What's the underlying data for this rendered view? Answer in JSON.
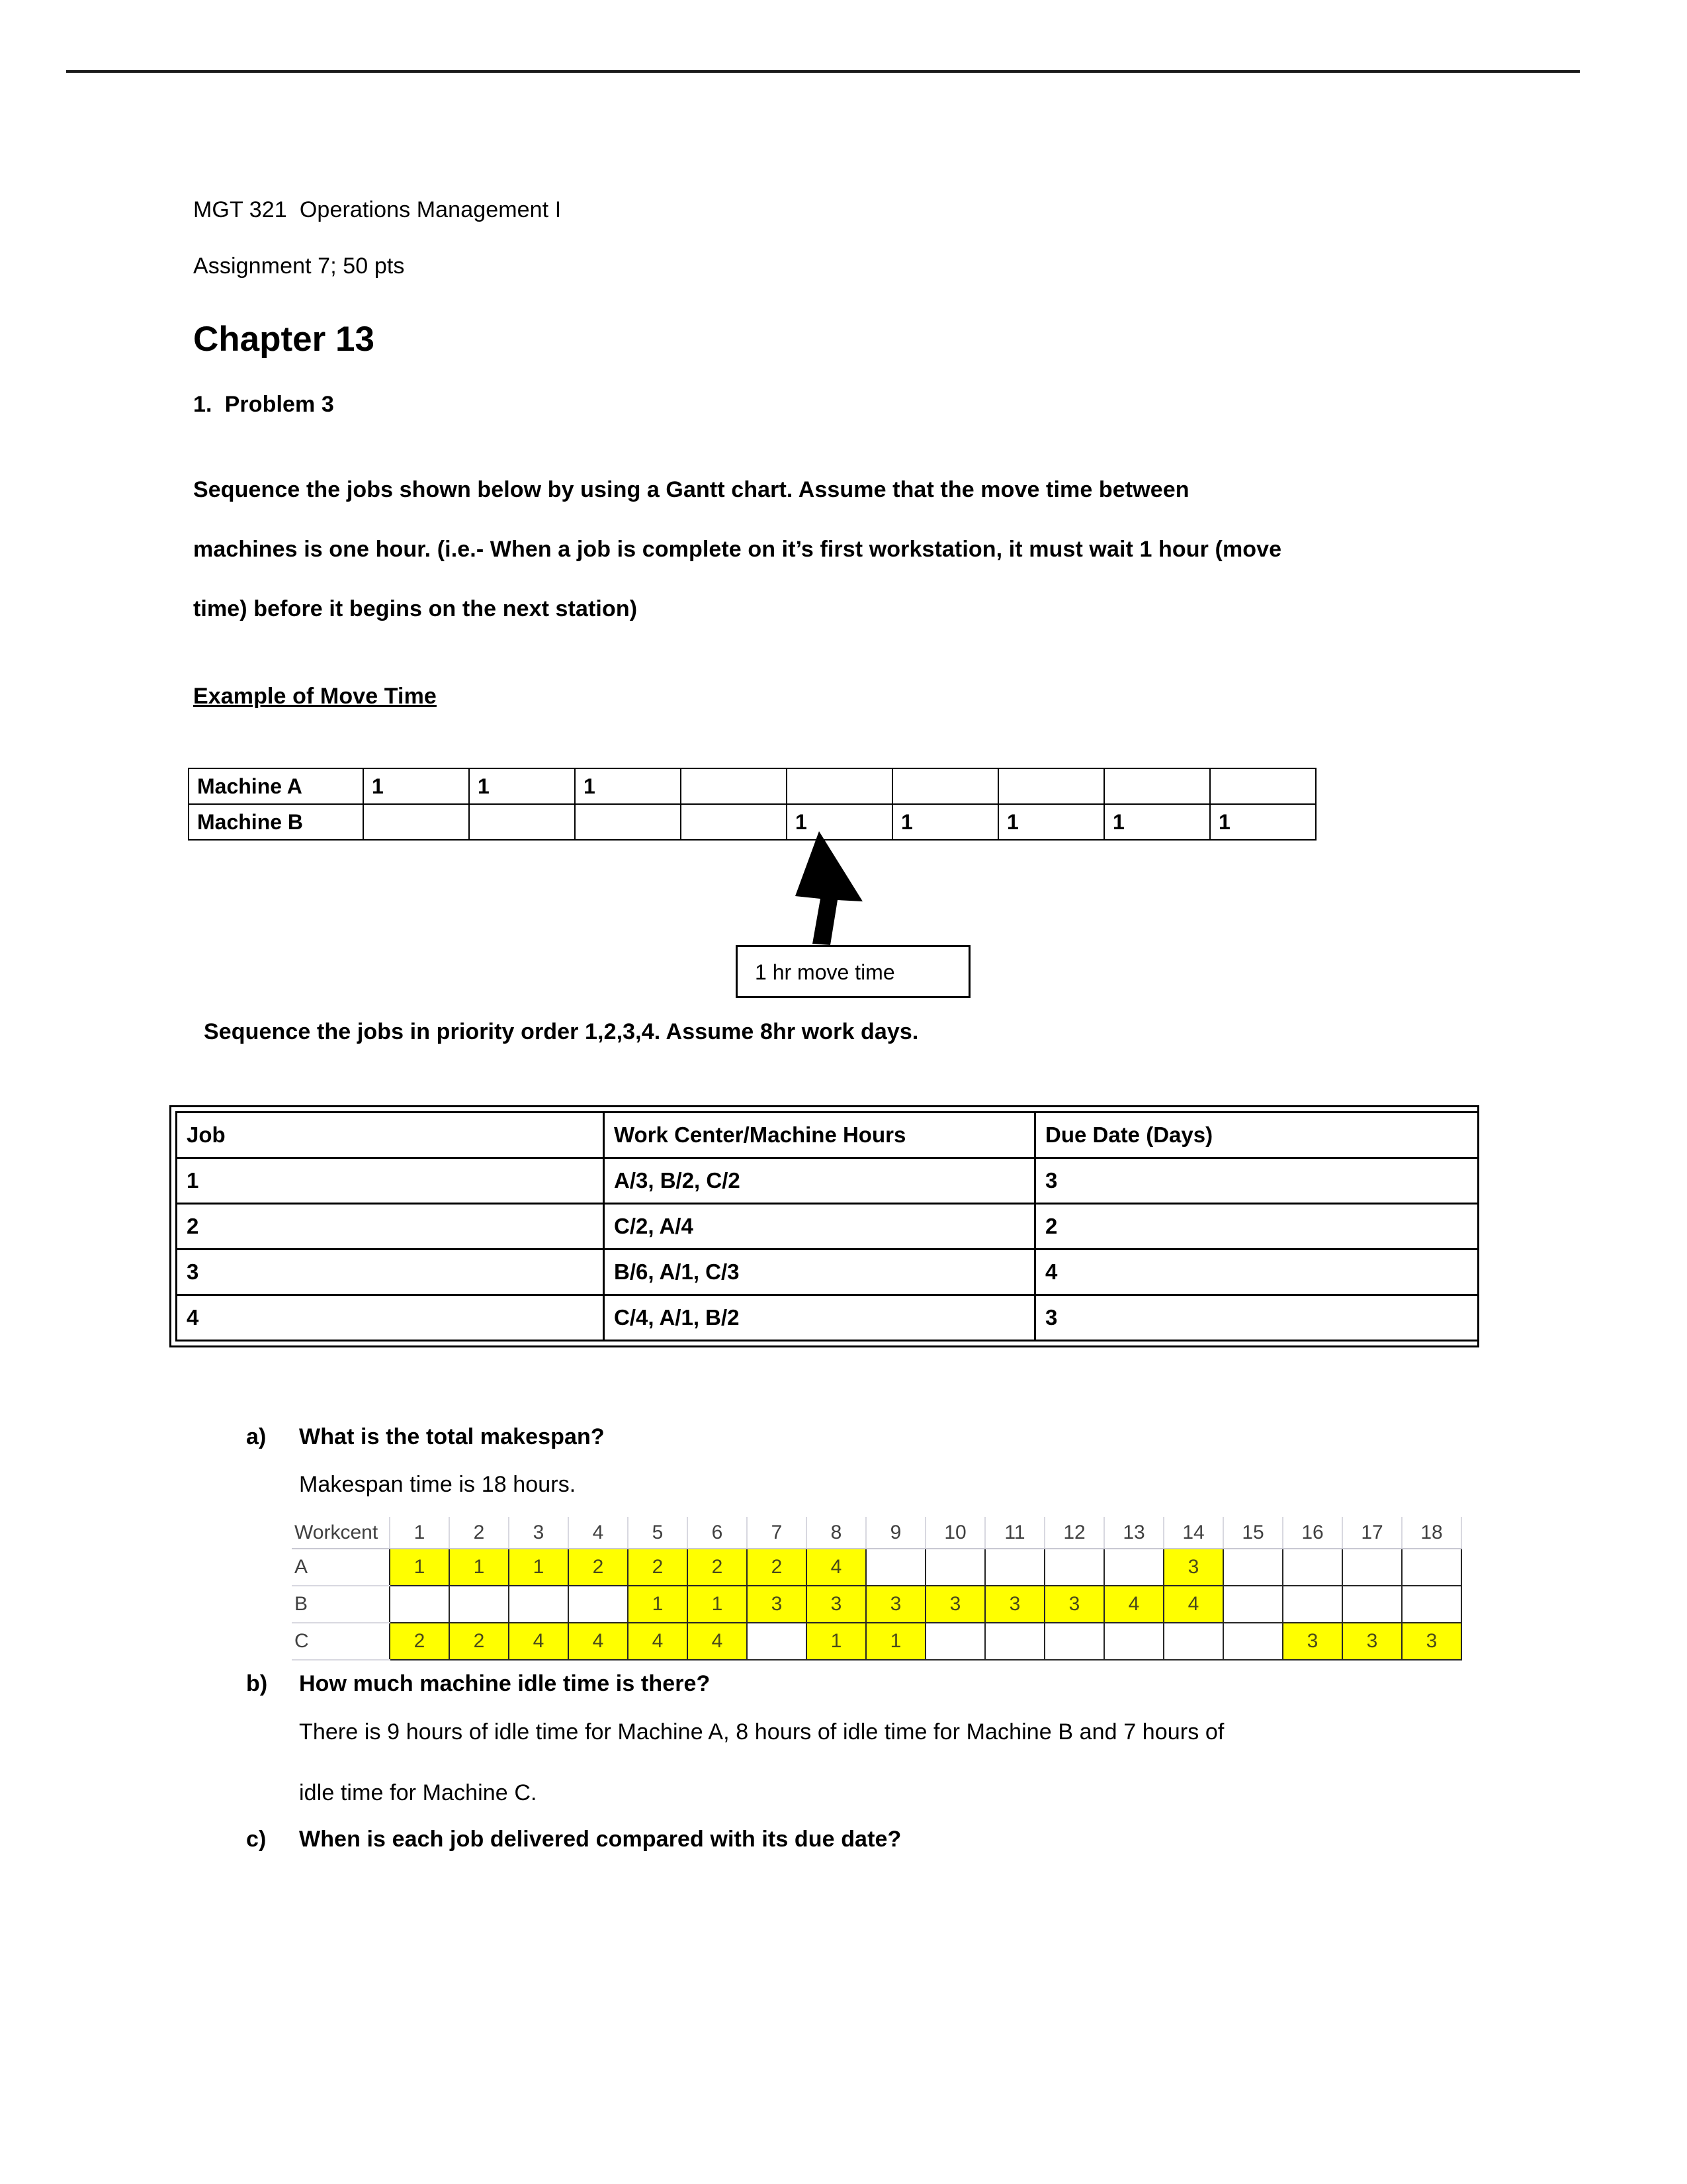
{
  "document": {
    "course_line": "MGT 321  Operations Management I",
    "assignment_line": "Assignment 7; 50 pts",
    "chapter_title": "Chapter 13",
    "problem_label": "1.  Problem 3",
    "instructions_line_1": "Sequence the jobs shown below by using a Gantt chart. Assume that the move time between",
    "instructions_line_2": "machines is one hour. (i.e.- When a job is complete on it’s first workstation, it must wait 1 hour (move",
    "instructions_line_3": "time) before it begins on the next station)",
    "example_heading": "Example of Move Time",
    "sequence_note": "Sequence the jobs in priority order 1,2,3,4. Assume 8hr work days.",
    "callout_text": "1 hr move time"
  },
  "move_time_table": {
    "rows": [
      {
        "label": "Machine A",
        "cells": [
          "1",
          "1",
          "1",
          "",
          "",
          "",
          "",
          "",
          ""
        ]
      },
      {
        "label": "Machine B",
        "cells": [
          "",
          "",
          "",
          "",
          "1",
          "1",
          "1",
          "1",
          "1"
        ]
      }
    ]
  },
  "jobs_table": {
    "headers": [
      "Job",
      "Work Center/Machine Hours",
      "Due Date (Days)"
    ],
    "rows": [
      [
        "1",
        "A/3, B/2, C/2",
        "3"
      ],
      [
        "2",
        "C/2, A/4",
        "2"
      ],
      [
        "3",
        "B/6, A/1, C/3",
        "4"
      ],
      [
        "4",
        "C/4, A/1, B/2",
        "3"
      ]
    ]
  },
  "questions": {
    "a_label": "a)",
    "a_text": "What is the total makespan?",
    "a_answer": "Makespan time is 18 hours.",
    "b_label": "b)",
    "b_text": "How much machine idle time is there?",
    "b_answer_line_1": "There is 9 hours of idle time for Machine A, 8 hours of idle time for Machine B and 7 hours of",
    "b_answer_line_2": "idle time for Machine C.",
    "c_label": "c)",
    "c_text": "When is each job delivered compared with its due date?"
  },
  "chart_data": {
    "type": "gantt",
    "title": "Gantt chart of job sequencing",
    "corner_label": "Workcent",
    "xlabel": "",
    "ylabel": "",
    "time_units": "hours",
    "makespan": 18,
    "highlight_color": "#FFFF00",
    "categories": [
      "1",
      "2",
      "3",
      "4",
      "5",
      "6",
      "7",
      "8",
      "9",
      "10",
      "11",
      "12",
      "13",
      "14",
      "15",
      "16",
      "17",
      "18"
    ],
    "rows": [
      {
        "workcenter": "A",
        "cells": [
          "1",
          "1",
          "1",
          "2",
          "2",
          "2",
          "2",
          "4",
          "",
          "",
          "",
          "",
          "",
          "3",
          "",
          "",
          "",
          ""
        ],
        "tasks": [
          {
            "job": "1",
            "start": 1,
            "end": 3
          },
          {
            "job": "2",
            "start": 4,
            "end": 7
          },
          {
            "job": "4",
            "start": 8,
            "end": 8
          },
          {
            "job": "3",
            "start": 14,
            "end": 14
          }
        ],
        "idle_hours": 9
      },
      {
        "workcenter": "B",
        "cells": [
          "",
          "",
          "",
          "",
          "1",
          "1",
          "3",
          "3",
          "3",
          "3",
          "3",
          "3",
          "4",
          "4",
          "",
          "",
          "",
          ""
        ],
        "tasks": [
          {
            "job": "1",
            "start": 5,
            "end": 6
          },
          {
            "job": "3",
            "start": 7,
            "end": 12
          },
          {
            "job": "4",
            "start": 13,
            "end": 14
          }
        ],
        "idle_hours": 8
      },
      {
        "workcenter": "C",
        "cells": [
          "2",
          "2",
          "4",
          "4",
          "4",
          "4",
          "",
          "1",
          "1",
          "",
          "",
          "",
          "",
          "",
          "",
          "3",
          "3",
          "3"
        ],
        "tasks": [
          {
            "job": "2",
            "start": 1,
            "end": 2
          },
          {
            "job": "4",
            "start": 3,
            "end": 6
          },
          {
            "job": "1",
            "start": 8,
            "end": 9
          },
          {
            "job": "3",
            "start": 16,
            "end": 18
          }
        ],
        "idle_hours": 7
      }
    ]
  }
}
